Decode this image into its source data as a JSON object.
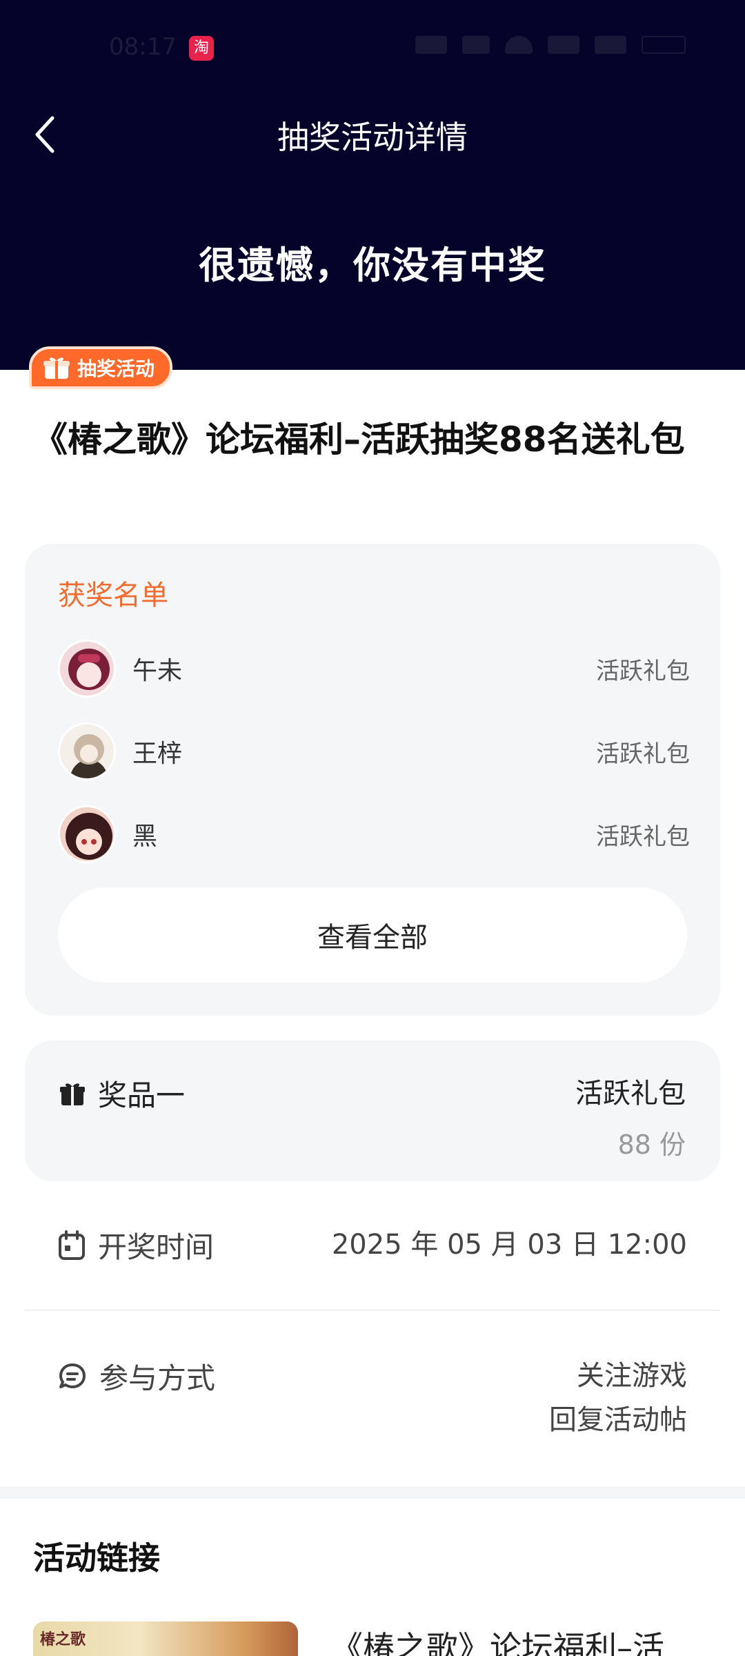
{
  "status_bar": {
    "time": "08:17",
    "app_icon_glyph": "淘"
  },
  "nav": {
    "title": "抽奖活动详情"
  },
  "result": {
    "message": "很遗憾，你没有中奖"
  },
  "badge": {
    "label": "抽奖活动"
  },
  "activity": {
    "title": "《椿之歌》论坛福利–活跃抽奖88名送礼包"
  },
  "winners": {
    "heading": "获奖名单",
    "items": [
      {
        "name": "午未",
        "prize": "活跃礼包",
        "avatar_colors": [
          "#7a1f3a",
          "#c0395a",
          "#f3d8dc"
        ]
      },
      {
        "name": "王梓",
        "prize": "活跃礼包",
        "avatar_colors": [
          "#6b5a4a",
          "#c9b7a3",
          "#f4efe9"
        ]
      },
      {
        "name": "黑",
        "prize": "活跃礼包",
        "avatar_colors": [
          "#3a1a1a",
          "#b43434",
          "#f2d2c8"
        ]
      }
    ],
    "view_all_label": "查看全部"
  },
  "prize": {
    "label": "奖品一",
    "name": "活跃礼包",
    "count": "88 份"
  },
  "draw_time": {
    "label": "开奖时间",
    "value": "2025 年 05 月 03 日 12:00"
  },
  "participation": {
    "label": "参与方式",
    "methods": [
      "关注游戏",
      "回复活动帖"
    ]
  },
  "activity_link": {
    "heading": "活动链接",
    "thumb_label": "椿之歌",
    "title": "《椿之歌》论坛福利–活"
  },
  "colors": {
    "header_bg": "#06032b",
    "accent": "#f26b2f",
    "badge_bg": "#ff6a2a",
    "card_bg": "#f5f6f8"
  }
}
